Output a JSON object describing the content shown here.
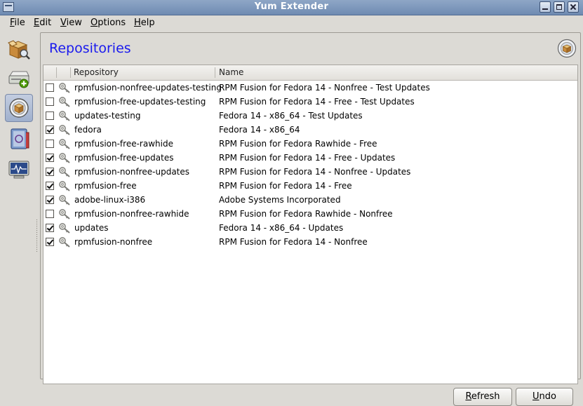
{
  "window": {
    "title": "Yum Extender"
  },
  "menu": [
    {
      "accel": "F",
      "rest": "ile"
    },
    {
      "accel": "E",
      "rest": "dit"
    },
    {
      "accel": "V",
      "rest": "iew"
    },
    {
      "accel": "O",
      "rest": "ptions"
    },
    {
      "accel": "H",
      "rest": "elp"
    }
  ],
  "sidebar": {
    "items": [
      {
        "icon": "packages-icon",
        "active": false
      },
      {
        "icon": "install-drive-icon",
        "active": false
      },
      {
        "icon": "repositories-icon",
        "active": true
      },
      {
        "icon": "history-book-icon",
        "active": false
      },
      {
        "icon": "output-monitor-icon",
        "active": false
      }
    ]
  },
  "panel": {
    "title": "Repositories"
  },
  "table": {
    "columns": [
      "Repository",
      "Name"
    ],
    "rows": [
      {
        "checked": false,
        "repo": "rpmfusion-nonfree-updates-testing",
        "name": "RPM Fusion for Fedora 14 - Nonfree - Test Updates"
      },
      {
        "checked": false,
        "repo": "rpmfusion-free-updates-testing",
        "name": "RPM Fusion for Fedora 14 - Free - Test Updates"
      },
      {
        "checked": false,
        "repo": "updates-testing",
        "name": "Fedora 14 - x86_64 - Test Updates"
      },
      {
        "checked": true,
        "repo": "fedora",
        "name": "Fedora 14 - x86_64"
      },
      {
        "checked": false,
        "repo": "rpmfusion-free-rawhide",
        "name": "RPM Fusion for Fedora Rawhide - Free"
      },
      {
        "checked": true,
        "repo": "rpmfusion-free-updates",
        "name": "RPM Fusion for Fedora 14 - Free - Updates"
      },
      {
        "checked": true,
        "repo": "rpmfusion-nonfree-updates",
        "name": "RPM Fusion for Fedora 14 - Nonfree - Updates"
      },
      {
        "checked": true,
        "repo": "rpmfusion-free",
        "name": "RPM Fusion for Fedora 14 - Free"
      },
      {
        "checked": true,
        "repo": "adobe-linux-i386",
        "name": "Adobe Systems Incorporated"
      },
      {
        "checked": false,
        "repo": "rpmfusion-nonfree-rawhide",
        "name": "RPM Fusion for Fedora Rawhide - Nonfree"
      },
      {
        "checked": true,
        "repo": "updates",
        "name": "Fedora 14 - x86_64 - Updates"
      },
      {
        "checked": true,
        "repo": "rpmfusion-nonfree",
        "name": "RPM Fusion for Fedora 14 - Nonfree"
      }
    ]
  },
  "buttons": {
    "refresh": {
      "accel": "R",
      "rest": "efresh"
    },
    "undo": {
      "accel": "U",
      "rest": "ndo"
    }
  }
}
